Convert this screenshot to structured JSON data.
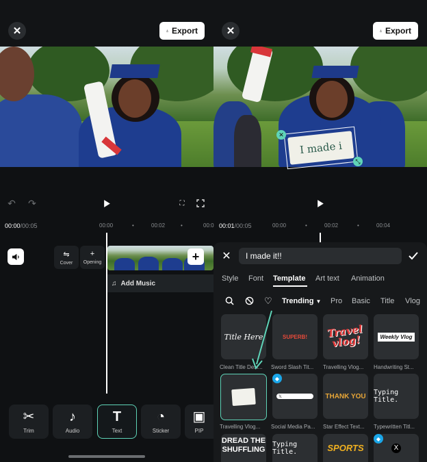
{
  "left": {
    "export_label": "Export",
    "timecode_current": "00:00",
    "timecode_total": "/00:05",
    "ticks": [
      "00:00",
      "•",
      "00:02",
      "•",
      "00:0"
    ],
    "cover_label": "Cover",
    "opening_label": "Opening",
    "add_music_label": "Add Music",
    "tools": [
      {
        "label": "Trim",
        "icon": "scissors-icon"
      },
      {
        "label": "Audio",
        "icon": "music-note-icon"
      },
      {
        "label": "Text",
        "icon": "text-icon"
      },
      {
        "label": "Sticker",
        "icon": "sticker-icon"
      },
      {
        "label": "PIP",
        "icon": "picture-icon"
      }
    ]
  },
  "right": {
    "export_label": "Export",
    "overlay_text": "I made i",
    "timecode_current": "00:01",
    "timecode_total": "/00:05",
    "ticks": [
      "00:00",
      "•",
      "00:02",
      "•",
      "00:04"
    ],
    "text_value": "I made it!!",
    "tabs": [
      "Style",
      "Font",
      "Template",
      "Art text",
      "Animation"
    ],
    "active_tab": "Template",
    "filters": [
      "Trending",
      "Pro",
      "Basic",
      "Title",
      "Vlog"
    ],
    "active_filter": "Trending",
    "templates_row1": [
      {
        "label": "Clean Title Desi...",
        "preview": "Title Here"
      },
      {
        "label": "Sword Slash Tit...",
        "preview": "SUPERB!"
      },
      {
        "label": "Travelling Vlog...",
        "preview": "Travel vlog!"
      },
      {
        "label": "Handwriting St...",
        "preview": "Weekly Vlog"
      }
    ],
    "templates_row2": [
      {
        "label": "Travelling Vlog...",
        "preview": ""
      },
      {
        "label": "Social Media Pa...",
        "preview": ""
      },
      {
        "label": "Star Effect Text...",
        "preview": "THANK YOU"
      },
      {
        "label": "Typewritten Titl...",
        "preview": "Typing Title."
      }
    ],
    "templates_row3": [
      {
        "preview": "DREAD THE SHUFFLING"
      },
      {
        "preview": "Typing Title."
      },
      {
        "preview": "SPORTS"
      },
      {
        "preview": "X"
      }
    ],
    "accent": "#5fd4b8"
  }
}
